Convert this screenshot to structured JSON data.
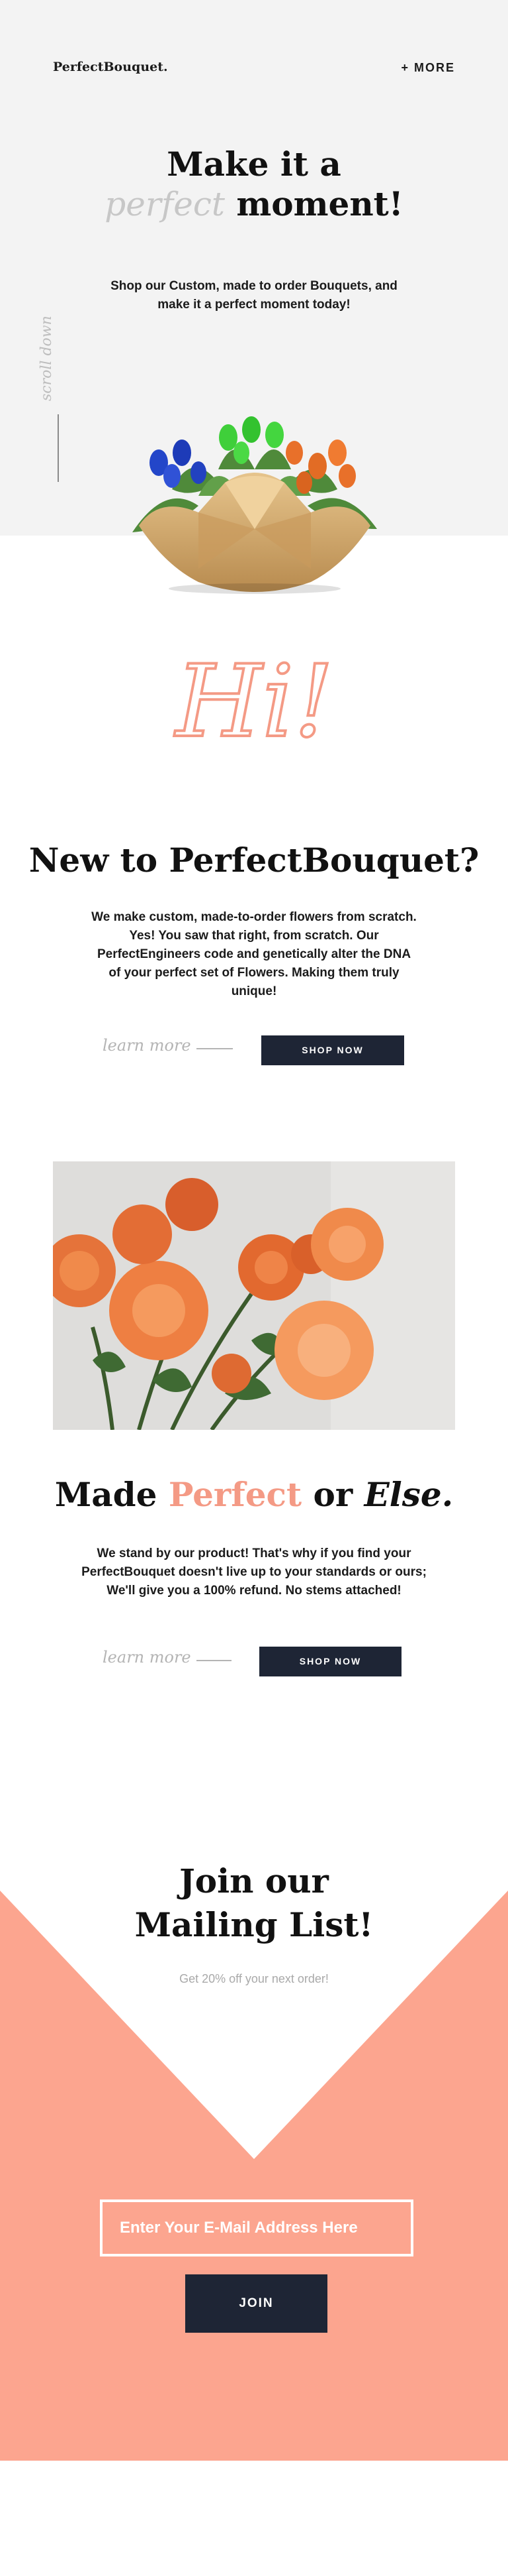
{
  "header": {
    "logo": "PerfectBouquet.",
    "more_label": "+ MORE"
  },
  "hero": {
    "title_line1": "Make it a",
    "title_line2_accent": "perfect",
    "title_line2_rest": " moment!",
    "subtitle": "Shop our Custom, made to order Bouquets, and make it a perfect moment today!",
    "scroll_label": "scroll down"
  },
  "intro": {
    "greeting": "Hi!",
    "title": "New to PerfectBouquet?",
    "body": "We make custom, made-to-order flowers from scratch. Yes! You saw that right, from scratch. Our PerfectEngineers code and genetically alter the DNA of your perfect set of Flowers. Making them truly unique!",
    "learn_more": "learn more",
    "shop_now": "SHOP NOW"
  },
  "guarantee": {
    "title_a": "Made ",
    "title_accent": "Perfect",
    "title_b": " or ",
    "title_italic": "Else.",
    "body": "We stand by our product! That's why if you find your PerfectBouquet doesn't live up to your standards or ours; We'll give you a 100% refund. No stems attached!",
    "learn_more": "learn more",
    "shop_now": "SHOP NOW"
  },
  "mailing": {
    "title_line1": "Join our",
    "title_line2": "Mailing List!",
    "subtitle": "Get 20% off your next order!",
    "email_placeholder": "Enter Your E-Mail Address Here",
    "join_label": "JOIN"
  },
  "colors": {
    "accent": "#f49a85",
    "dark": "#1e2535",
    "hero_bg": "#f3f3f3",
    "salmon": "#fca58f"
  }
}
